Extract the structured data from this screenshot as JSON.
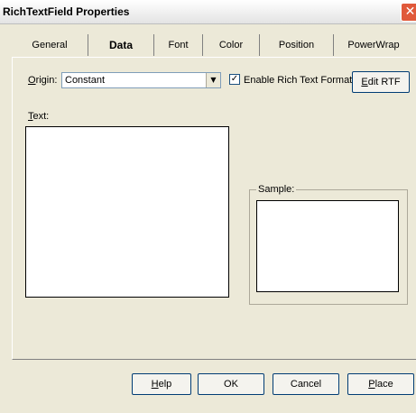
{
  "window": {
    "title": "RichTextField Properties",
    "close_symbol": "✕"
  },
  "tabs": [
    {
      "label": "General"
    },
    {
      "label": "Data"
    },
    {
      "label": "Font"
    },
    {
      "label": "Color"
    },
    {
      "label": "Position"
    },
    {
      "label": "PowerWrap"
    }
  ],
  "active_tab": "Data",
  "data_tab": {
    "origin_label_mnemonic": "O",
    "origin_label_rest": "rigin:",
    "origin_value": "Constant",
    "enable_rtf_checked": true,
    "enable_rtf_label": "Enable Rich Text Format",
    "edit_rtf_mnemonic": "E",
    "edit_rtf_rest": "dit RTF",
    "text_label_mnemonic": "T",
    "text_label_rest": "ext:",
    "text_value": "",
    "sample_label": "Sample:"
  },
  "footer": {
    "help_mnemonic": "H",
    "help_rest": "elp",
    "ok_label": "OK",
    "cancel_label": "Cancel",
    "place_mnemonic": "P",
    "place_rest": "lace"
  },
  "icons": {
    "dropdown": "▼",
    "check": "✓"
  }
}
